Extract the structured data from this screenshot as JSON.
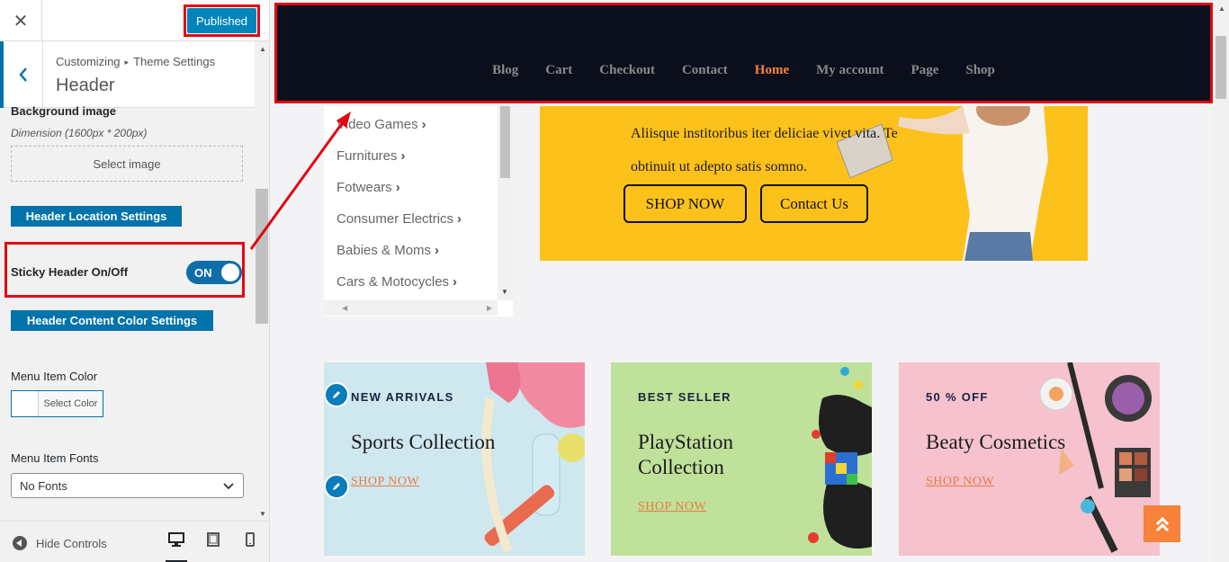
{
  "customizer": {
    "close_glyph": "✕",
    "publish_label": "Published",
    "breadcrumb_root": "Customizing",
    "breadcrumb_sep": "▸",
    "breadcrumb_section": "Theme Settings",
    "section_title": "Header",
    "background_image_label": "Background image",
    "dimension_note": "Dimension (1600px * 200px)",
    "select_image_label": "Select image",
    "location_settings_label": "Header Location Settings",
    "sticky_label": "Sticky Header On/Off",
    "sticky_toggle_text": "ON",
    "sticky_on": true,
    "content_color_label": "Header Content Color Settings",
    "menu_item_color_label": "Menu Item Color",
    "select_color_label": "Select Color",
    "menu_item_fonts_label": "Menu Item Fonts",
    "font_selected": "No Fonts",
    "hide_controls_label": "Hide Controls"
  },
  "preview": {
    "nav": [
      "Blog",
      "Cart",
      "Checkout",
      "Contact",
      "Home",
      "My account",
      "Page",
      "Shop"
    ],
    "nav_active": "Home",
    "categories": [
      "Video Games",
      "Furnitures",
      "Fotwears",
      "Consumer Electrics",
      "Babies & Moms",
      "Cars & Motocycles"
    ],
    "hero_text": "Aliisque institoribus iter deliciae vivet vita. Te obtinuit ut adepto satis somno.",
    "hero_shop": "SHOP NOW",
    "hero_contact": "Contact Us",
    "cards": [
      {
        "tag": "NEW ARRIVALS",
        "title": "Sports Collection",
        "link": "SHOP NOW"
      },
      {
        "tag": "BEST SELLER",
        "title": "PlayStation Collection",
        "link": "SHOP NOW"
      },
      {
        "tag": "50 % OFF",
        "title": "Beaty Cosmetics",
        "link": "SHOP NOW"
      }
    ]
  },
  "colors": {
    "accent": "#0073aa",
    "highlight": "#e30613",
    "nav_bg": "#0b0f1c",
    "nav_active": "#f7823a",
    "hero_bg": "#fdc11c"
  }
}
